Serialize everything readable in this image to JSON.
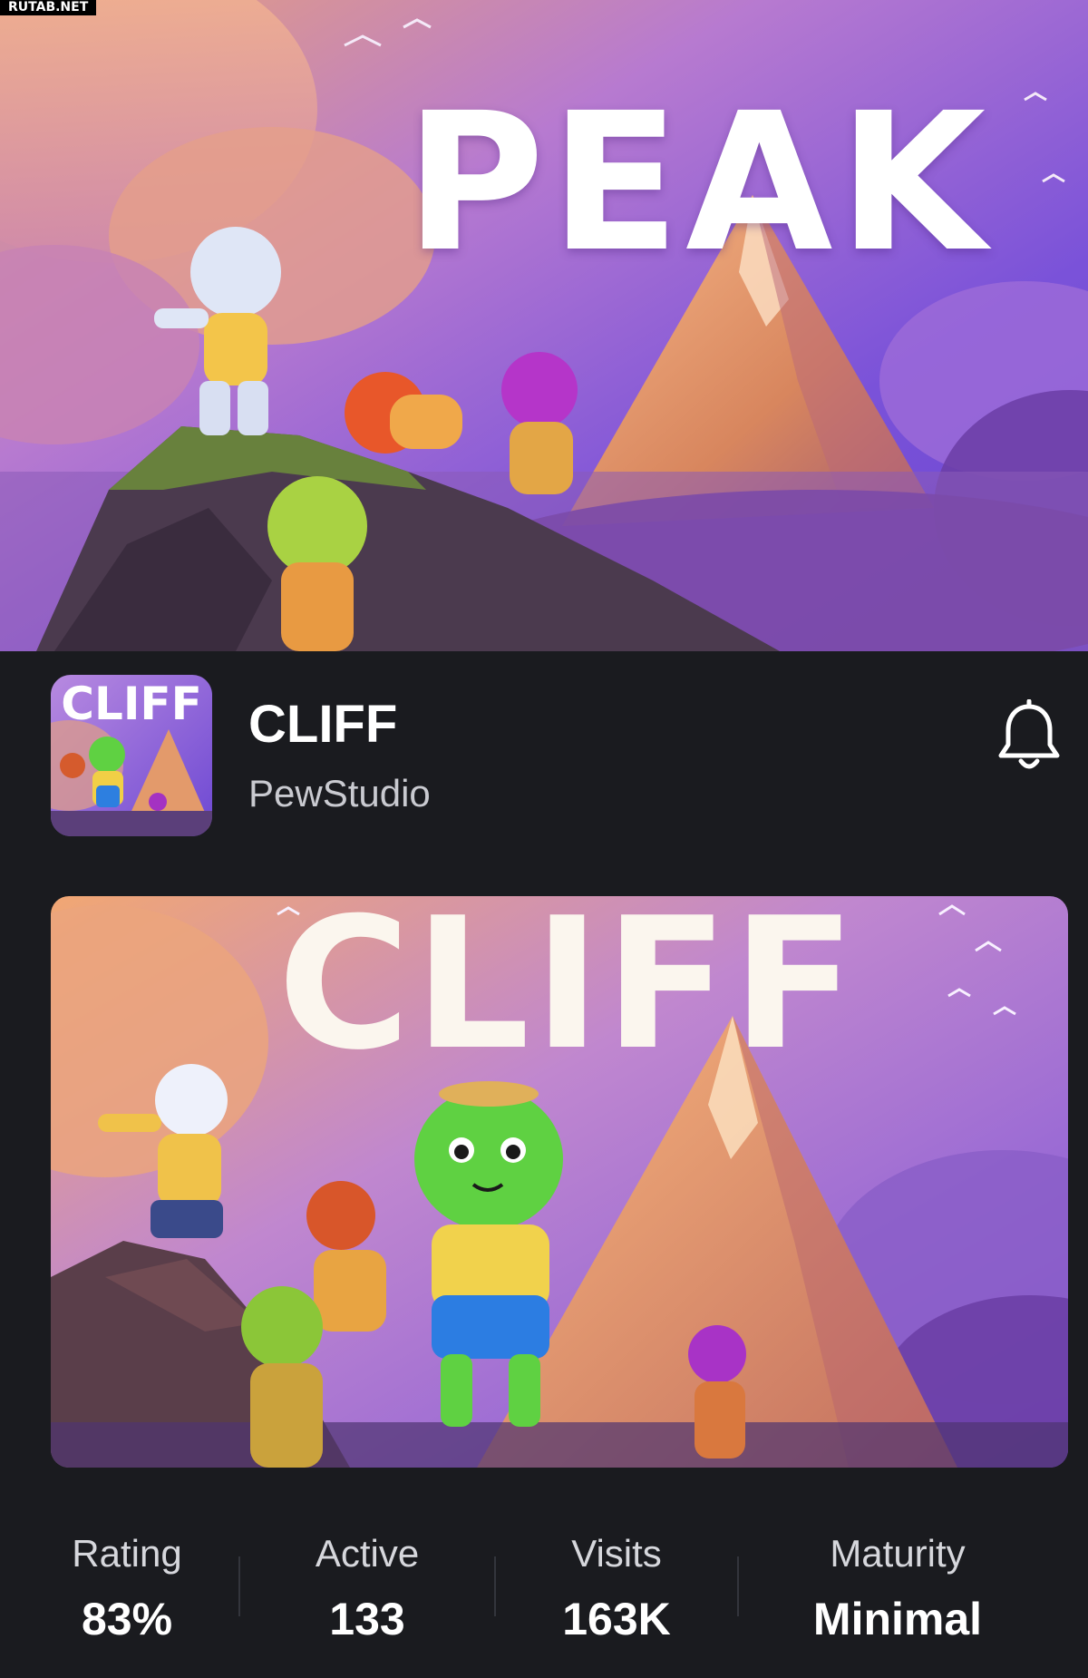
{
  "watermark": "RUTAB.NET",
  "hero": {
    "title": "PEAK"
  },
  "game": {
    "title": "CLIFF",
    "developer": "PewStudio",
    "icon_title": "CLIFF",
    "icon": "bell-icon"
  },
  "thumbnail": {
    "title": "CLIFF"
  },
  "stats": [
    {
      "label": "Rating",
      "value": "83%"
    },
    {
      "label": "Active",
      "value": "133"
    },
    {
      "label": "Visits",
      "value": "163K"
    },
    {
      "label": "Maturity",
      "value": "Minimal"
    }
  ],
  "colors": {
    "background": "#1a1b1f",
    "sky_purple": "#7b4ed8",
    "sky_orange": "#f2a46c",
    "text_primary": "#ffffff",
    "text_secondary": "#c9cad0"
  }
}
